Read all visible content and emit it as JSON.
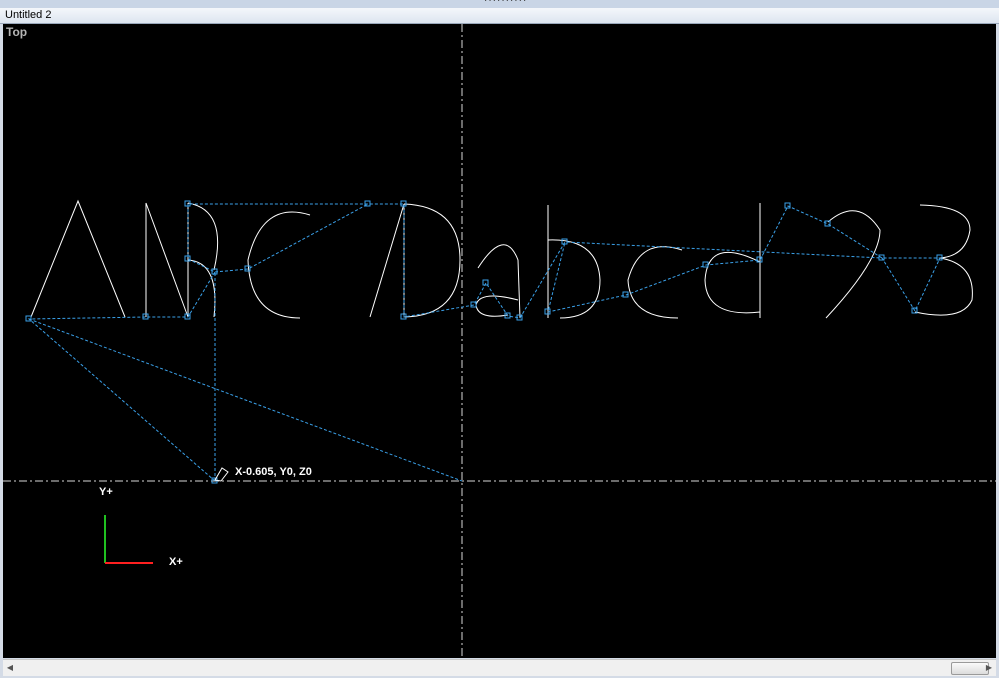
{
  "window": {
    "title": "Untitled 2",
    "grip": "··········"
  },
  "viewport": {
    "view_name": "Top",
    "coord_readout": "X-0.605, Y0, Z0",
    "axis_y_label": "Y+",
    "axis_x_label": "X+",
    "background": "#000000",
    "geometry_color": "#ffffff",
    "toolpath_color": "#3aa0e8",
    "x_axis_color": "#ff2020",
    "y_axis_color": "#20c020"
  },
  "scene_text": "ABCDabcd23",
  "scrollbar": {
    "left_arrow": "◀",
    "right_arrow": "▶"
  }
}
